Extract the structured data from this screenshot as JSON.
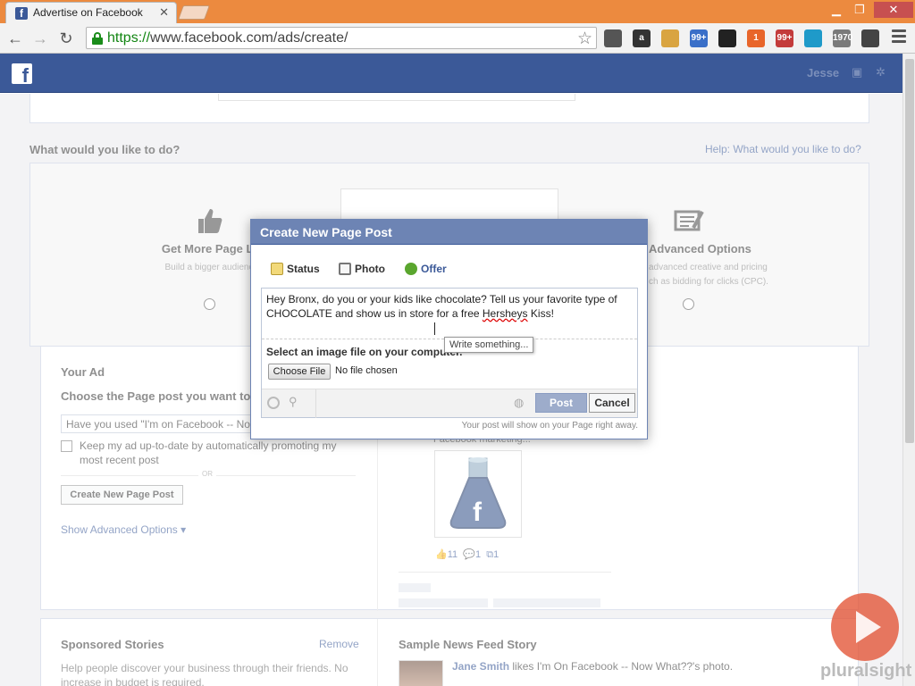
{
  "browser": {
    "tab_title": "Advertise on Facebook",
    "url_scheme": "https://",
    "url_rest": "www.facebook.com/ads/create/",
    "extensions": [
      {
        "name": "eyedropper-icon",
        "label": "",
        "color": "#555555"
      },
      {
        "name": "amazon-icon",
        "label": "a",
        "color": "#333333"
      },
      {
        "name": "cookie-icon",
        "label": "",
        "color": "#d9a441"
      },
      {
        "name": "badge-99-icon",
        "label": "99+",
        "color": "#3a6fc8"
      },
      {
        "name": "buffer-icon",
        "label": "",
        "color": "#222222"
      },
      {
        "name": "notifications-icon",
        "label": "1",
        "color": "#e8652a"
      },
      {
        "name": "mail-99-icon",
        "label": "99+",
        "color": "#c33b3b"
      },
      {
        "name": "sync-icon",
        "label": "",
        "color": "#1f9ac9"
      },
      {
        "name": "calendar-icon",
        "label": "1970",
        "color": "#7a7a7a"
      },
      {
        "name": "puzzle-icon",
        "label": "",
        "color": "#444444"
      }
    ]
  },
  "fb": {
    "logo": "f",
    "user": "Jesse"
  },
  "page": {
    "section_title": "What would you like to do?",
    "help_link": "Help: What would you like to do?",
    "choices": [
      {
        "title": "Get More Page Li",
        "desc": "Build a bigger audienc"
      },
      {
        "title": "Advanced Options",
        "desc_1": "advanced creative and pricing",
        "desc_2": "ch as bidding for clicks (CPC)."
      }
    ],
    "your_ad": {
      "title": "Your Ad",
      "choose_label": "Choose the Page post you want to",
      "select_value": "Have you used \"I'm on Facebook -- No",
      "checkbox_label": "Keep my ad up-to-date by automatically promoting my most recent post",
      "or_label": "OR",
      "create_button": "Create New Page Post",
      "advanced_link": "Show Advanced Options ▾"
    },
    "preview": {
      "caption": "Facebook marketing...",
      "likes": "11",
      "comments": "1",
      "shares": "1"
    },
    "sponsored": {
      "title": "Sponsored Stories",
      "remove": "Remove",
      "desc": "Help people discover your business through their friends. No increase in budget is required."
    },
    "newsfeed": {
      "title": "Sample News Feed Story",
      "name": "Jane Smith",
      "story": " likes I'm On Facebook -- Now What??'s photo."
    }
  },
  "dialog": {
    "title": "Create New Page Post",
    "tabs": [
      "Status",
      "Photo",
      "Offer"
    ],
    "post_text_before": "Hey Bronx, do you or your kids like chocolate? Tell us your favorite type of CHOCOLATE and show us in store for a free ",
    "post_text_misspelled": "Hersheys",
    "post_text_after": " Kiss!",
    "tooltip": "Write something...",
    "file_label": "Select an image file on your comp",
    "file_label_tail": "uter.",
    "choose_file": "Choose File",
    "no_file": "No file chosen",
    "post_button": "Post",
    "cancel_button": "Cancel",
    "note": "Your post will show on your Page right away."
  },
  "watermark": {
    "brand": "pluralsight"
  }
}
